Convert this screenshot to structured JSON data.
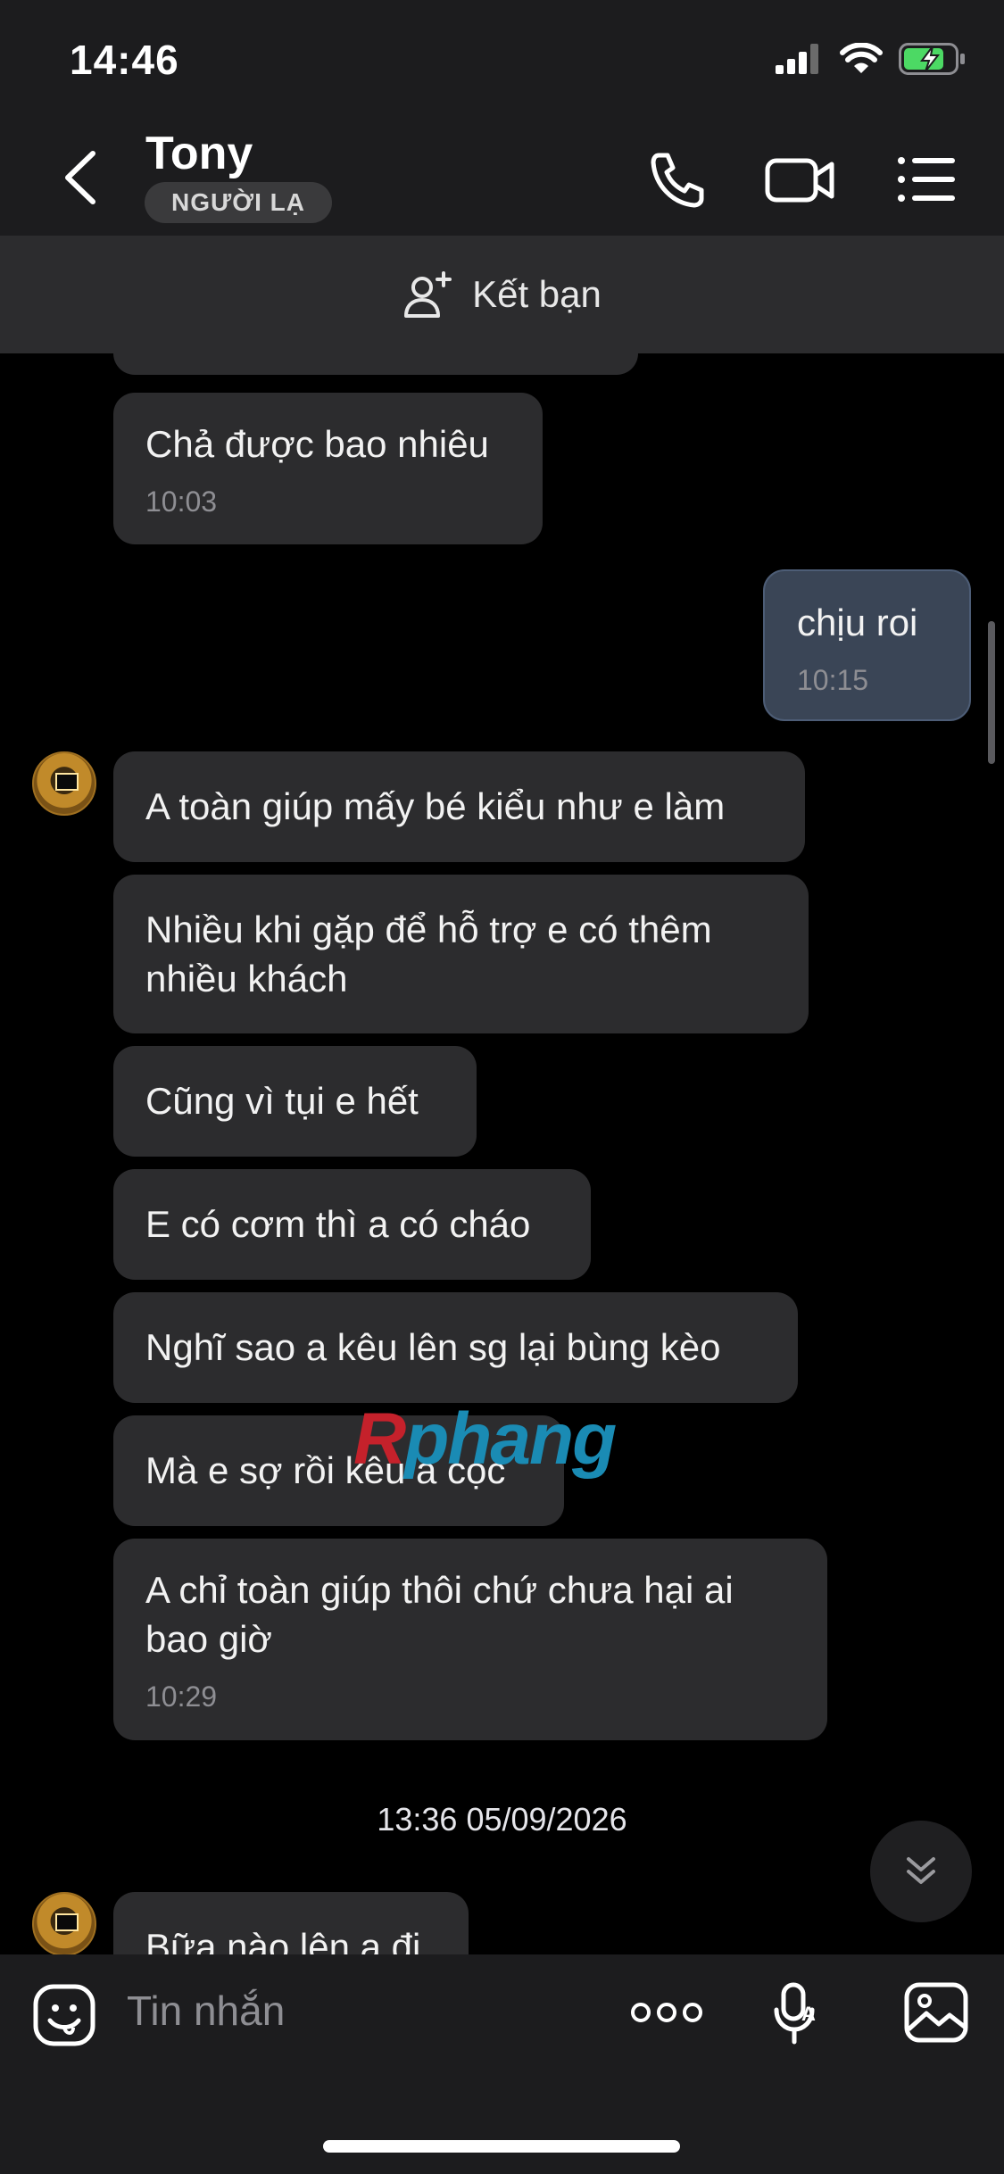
{
  "status_bar": {
    "time": "14:46",
    "battery_color": "#4cd964"
  },
  "header": {
    "contact_name": "Tony",
    "badge": "NGƯỜI LẠ",
    "icons": [
      "chevron-left-icon",
      "phone-icon",
      "video-camera-icon",
      "list-menu-icon"
    ]
  },
  "add_friend": {
    "label": "Kết bạn",
    "icon": "add-user-icon"
  },
  "messages": [
    {
      "text": "Chả được bao nhiêu",
      "time": "10:03",
      "from": "them"
    },
    {
      "text": "chịu roi",
      "time": "10:15",
      "from": "me"
    },
    {
      "text": "A toàn giúp mấy bé kiểu như e làm",
      "from": "them"
    },
    {
      "text": "Nhiều khi gặp để hỗ trợ e có thêm nhiều khách",
      "from": "them"
    },
    {
      "text": "Cũng vì tụi e hết",
      "from": "them"
    },
    {
      "text": "E có cơm thì a có cháo",
      "from": "them"
    },
    {
      "text": "Nghĩ sao a kêu lên sg lại bùng kèo",
      "from": "them"
    },
    {
      "text": "Mà e sợ rồi kêu a cọc",
      "from": "them"
    },
    {
      "text": "A chỉ toàn giúp thôi chứ chưa hại ai bao giờ",
      "time": "10:29",
      "from": "them"
    },
    {
      "text": "Bữa nào lên a đi",
      "from": "them"
    }
  ],
  "date_separator": "13:36 05/09/2026",
  "watermark": {
    "part1": "R",
    "part2": "phang"
  },
  "input_bar": {
    "placeholder": "Tin nhắn",
    "icons": [
      "sticker-face-icon",
      "more-dots-icon",
      "voice-to-text-icon",
      "image-gallery-icon"
    ]
  }
}
